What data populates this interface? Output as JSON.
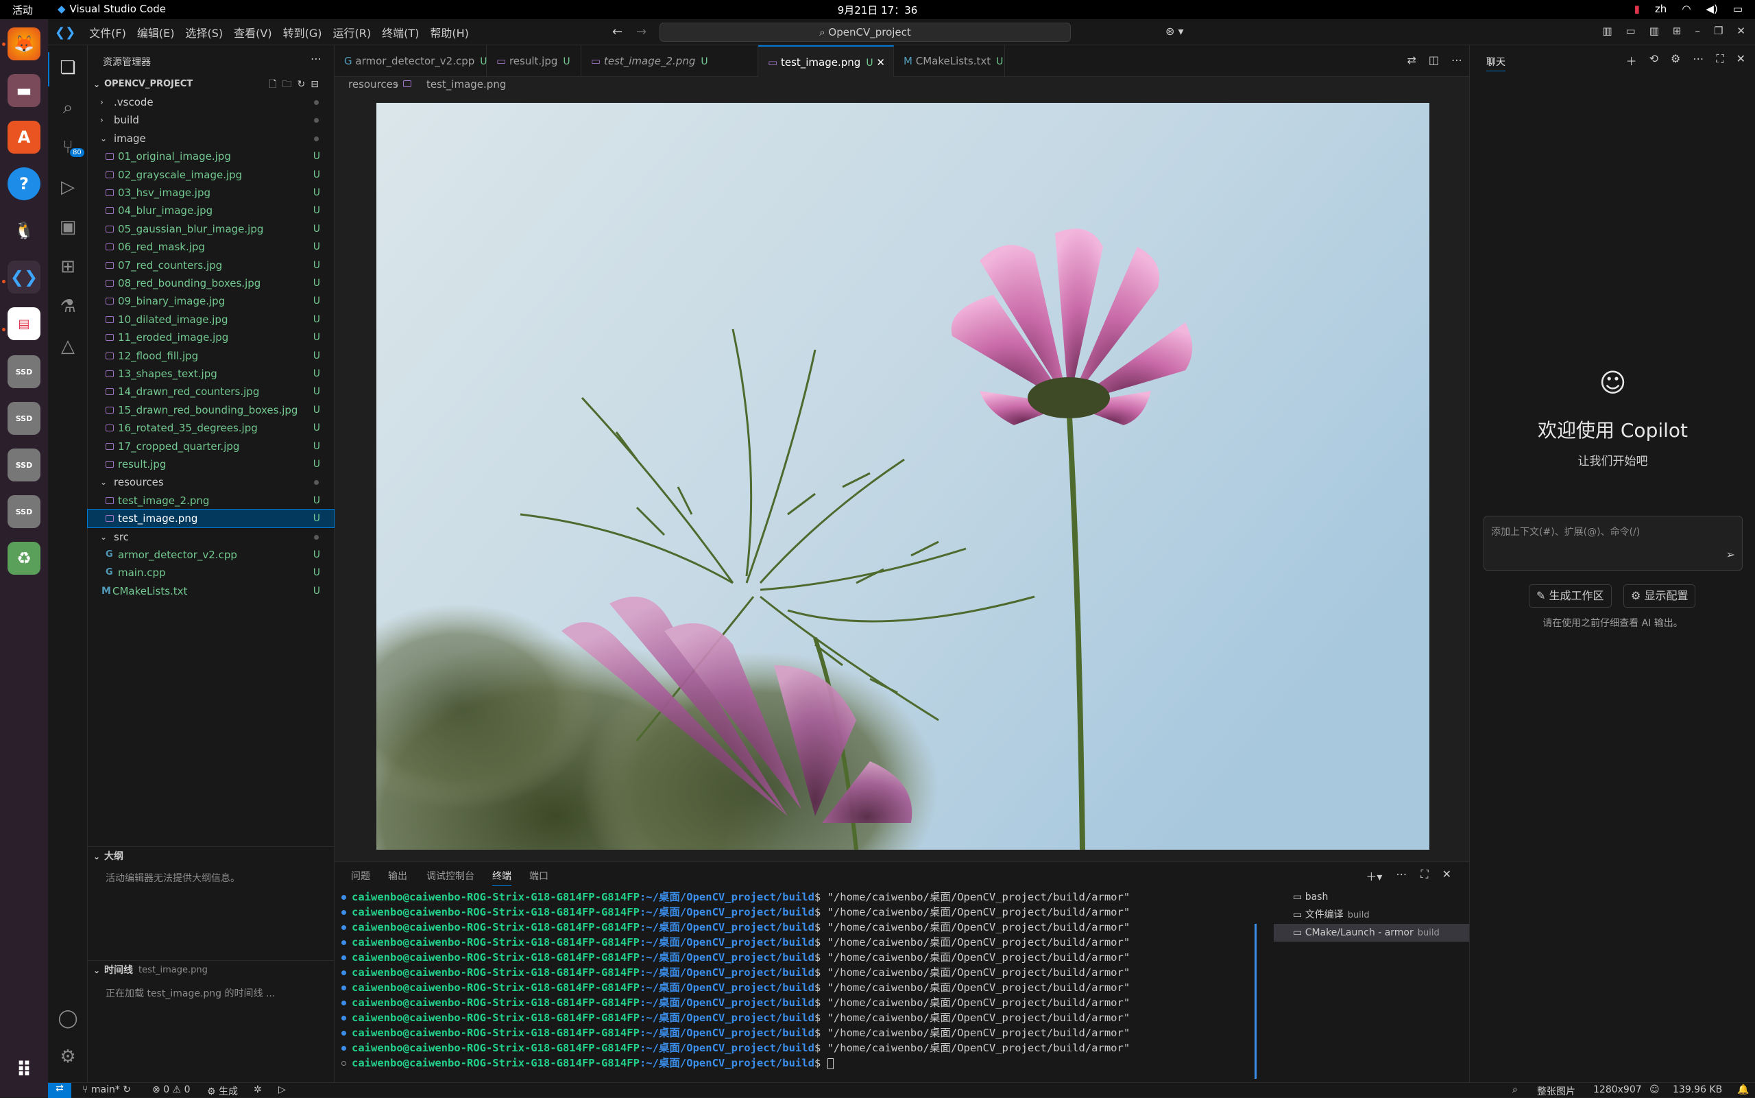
{
  "gnome": {
    "activities": "活动",
    "app_name": "Visual Studio Code",
    "clock": "9月21日 17：36",
    "lang": "zh"
  },
  "vscode": {
    "menu": [
      "文件(F)",
      "编辑(E)",
      "选择(S)",
      "查看(V)",
      "转到(G)",
      "运行(R)",
      "终端(T)",
      "帮助(H)"
    ],
    "search": "OpenCV_project",
    "scm_badge": "80"
  },
  "explorer": {
    "title": "资源管理器",
    "root": "OPENCV_PROJECT",
    "items": [
      {
        "label": ".vscode",
        "type": "folder-closed",
        "depth": 1
      },
      {
        "label": "build",
        "type": "folder-closed",
        "depth": 1
      },
      {
        "label": "image",
        "type": "folder-open",
        "depth": 1
      },
      {
        "label": "01_original_image.jpg",
        "type": "img",
        "depth": 2,
        "badge": "U"
      },
      {
        "label": "02_grayscale_image.jpg",
        "type": "img",
        "depth": 2,
        "badge": "U"
      },
      {
        "label": "03_hsv_image.jpg",
        "type": "img",
        "depth": 2,
        "badge": "U"
      },
      {
        "label": "04_blur_image.jpg",
        "type": "img",
        "depth": 2,
        "badge": "U"
      },
      {
        "label": "05_gaussian_blur_image.jpg",
        "type": "img",
        "depth": 2,
        "badge": "U"
      },
      {
        "label": "06_red_mask.jpg",
        "type": "img",
        "depth": 2,
        "badge": "U"
      },
      {
        "label": "07_red_counters.jpg",
        "type": "img",
        "depth": 2,
        "badge": "U"
      },
      {
        "label": "08_red_bounding_boxes.jpg",
        "type": "img",
        "depth": 2,
        "badge": "U"
      },
      {
        "label": "09_binary_image.jpg",
        "type": "img",
        "depth": 2,
        "badge": "U"
      },
      {
        "label": "10_dilated_image.jpg",
        "type": "img",
        "depth": 2,
        "badge": "U"
      },
      {
        "label": "11_eroded_image.jpg",
        "type": "img",
        "depth": 2,
        "badge": "U"
      },
      {
        "label": "12_flood_fill.jpg",
        "type": "img",
        "depth": 2,
        "badge": "U"
      },
      {
        "label": "13_shapes_text.jpg",
        "type": "img",
        "depth": 2,
        "badge": "U"
      },
      {
        "label": "14_drawn_red_counters.jpg",
        "type": "img",
        "depth": 2,
        "badge": "U"
      },
      {
        "label": "15_drawn_red_bounding_boxes.jpg",
        "type": "img",
        "depth": 2,
        "badge": "U"
      },
      {
        "label": "16_rotated_35_degrees.jpg",
        "type": "img",
        "depth": 2,
        "badge": "U"
      },
      {
        "label": "17_cropped_quarter.jpg",
        "type": "img",
        "depth": 2,
        "badge": "U"
      },
      {
        "label": "result.jpg",
        "type": "img",
        "depth": 2,
        "badge": "U"
      },
      {
        "label": "resources",
        "type": "folder-open",
        "depth": 1
      },
      {
        "label": "test_image_2.png",
        "type": "img",
        "depth": 2,
        "badge": "U"
      },
      {
        "label": "test_image.png",
        "type": "img",
        "depth": 2,
        "badge": "U",
        "selected": true
      },
      {
        "label": "src",
        "type": "folder-open",
        "depth": 1
      },
      {
        "label": "armor_detector_v2.cpp",
        "type": "cpp",
        "depth": 2,
        "badge": "U"
      },
      {
        "label": "main.cpp",
        "type": "cpp",
        "depth": 2,
        "badge": "U"
      },
      {
        "label": "CMakeLists.txt",
        "type": "cmake",
        "depth": 1,
        "badge": "U"
      }
    ],
    "outline_title": "大纲",
    "outline_msg": "活动编辑器无法提供大纲信息。",
    "timeline_title": "时间线",
    "timeline_file": "test_image.png",
    "timeline_msg": "正在加载 test_image.png 的时间线 ..."
  },
  "tabs": [
    {
      "label": "armor_detector_v2.cpp",
      "badge": "U",
      "icon": "cpp"
    },
    {
      "label": "result.jpg",
      "badge": "U",
      "icon": "img"
    },
    {
      "label": "test_image_2.png",
      "badge": "U",
      "icon": "img",
      "italic": true
    },
    {
      "label": "test_image.png",
      "badge": "U",
      "icon": "img",
      "active": true
    },
    {
      "label": "CMakeLists.txt",
      "badge": "U",
      "icon": "cmake"
    }
  ],
  "breadcrumb": {
    "folder": "resources",
    "file": "test_image.png"
  },
  "panel": {
    "tabs": [
      "问题",
      "输出",
      "调试控制台",
      "终端",
      "端口"
    ],
    "active_tab": "终端",
    "prompt_user": "caiwenbo@caiwenbo-ROG-Strix-G18-G814FP-G814FP",
    "prompt_path": ":~/桌面/OpenCV_project/build",
    "command": "$ \"/home/caiwenbo/桌面/OpenCV_project/build/armor\"",
    "last_prompt": "$ ",
    "terminals": [
      {
        "name": "bash",
        "sub": ""
      },
      {
        "name": "文件编译",
        "sub": "build"
      },
      {
        "name": "CMake/Launch - armor",
        "sub": "build"
      }
    ]
  },
  "chat": {
    "title": "聊天",
    "welcome": "欢迎使用 Copilot",
    "sub": "让我们开始吧",
    "placeholder": "添加上下文(#)、扩展(@)、命令(/)",
    "btn_workspace": "生成工作区",
    "btn_config": "显示配置",
    "note": "请在使用之前仔细查看 AI 输出。"
  },
  "status": {
    "branch": "main*",
    "errors": "0",
    "warnings": "0",
    "build": "生成",
    "whole_image": "整张图片",
    "dims": "1280x907",
    "size": "139.96 KB"
  },
  "colors": {
    "accent": "#0078d4",
    "git_untracked": "#73c991",
    "term_user": "#23d18b",
    "term_path": "#3b8eea"
  }
}
